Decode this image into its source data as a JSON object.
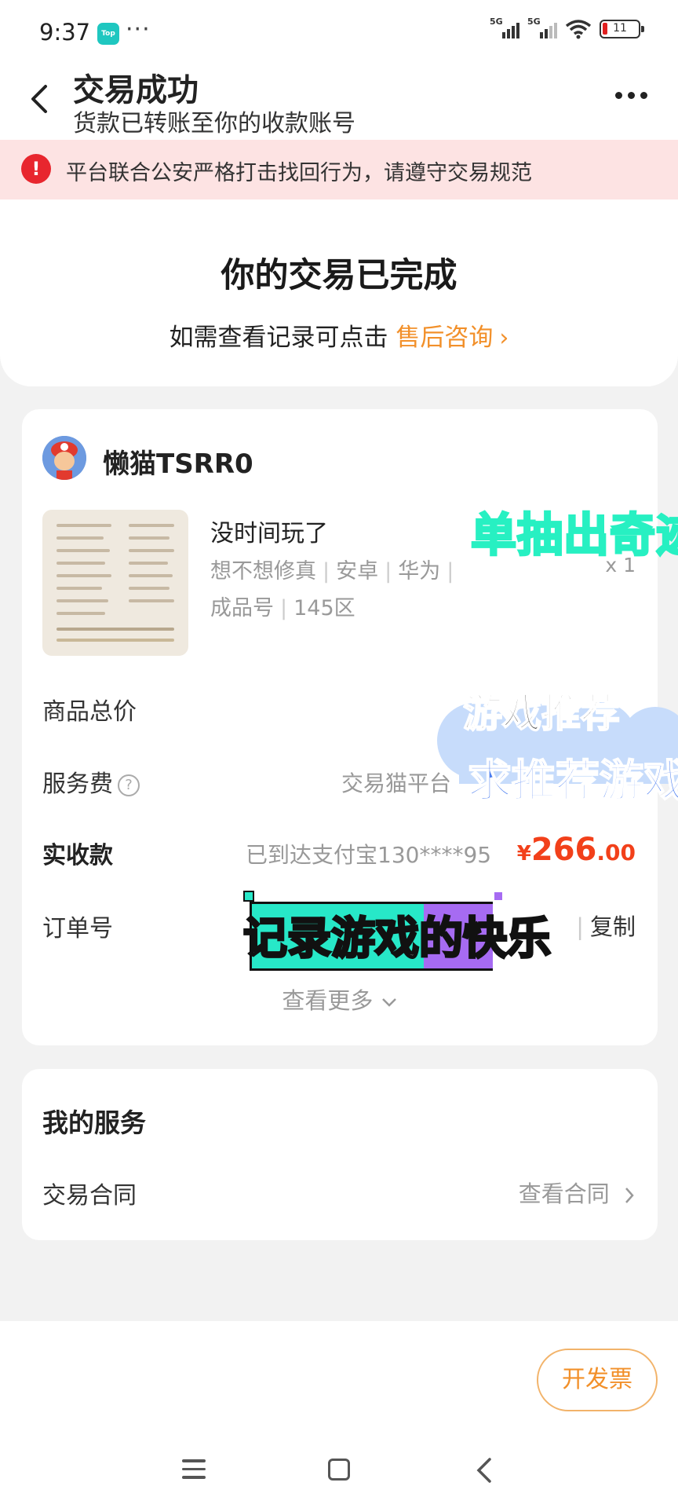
{
  "status_bar": {
    "time": "9:37",
    "app_badge": "Top",
    "more": "···",
    "net1": "5G",
    "net2": "5G",
    "battery": "11"
  },
  "header": {
    "title": "交易成功",
    "subtitle": "货款已转账至你的收款账号"
  },
  "notice": {
    "text": "平台联合公安严格打击找回行为，请遵守交易规范"
  },
  "complete": {
    "title": "你的交易已完成",
    "prompt": "如需查看记录可点击",
    "link": "售后咨询"
  },
  "order": {
    "seller": "懒猫TSRR0",
    "item_title": "没时间玩了",
    "tags1": [
      "想不想修真",
      "安卓",
      "华为"
    ],
    "tags2": [
      "成品号",
      "145区"
    ],
    "quantity": "x 1",
    "total_label": "商品总价",
    "fee_label": "服务费",
    "fee_value": "交易猫平台",
    "received_label": "实收款",
    "received_note": "已到达支付宝130****95",
    "currency": "¥",
    "amount_int": "266",
    "amount_dec": ".00",
    "order_no_label": "订单号",
    "copy": "复制",
    "more": "查看更多"
  },
  "services": {
    "title": "我的服务",
    "contract_label": "交易合同",
    "contract_link": "查看合同"
  },
  "bottom": {
    "invoice": "开发票"
  },
  "overlays": {
    "green": "单抽出奇迹",
    "strike": "游戏推荐",
    "blue": "求推荐游戏",
    "caption": "记录游戏的快乐"
  },
  "colors": {
    "accent": "#f2902a",
    "price": "#f2401a",
    "alert": "#e8262e",
    "notice_bg": "#fde3e3"
  }
}
